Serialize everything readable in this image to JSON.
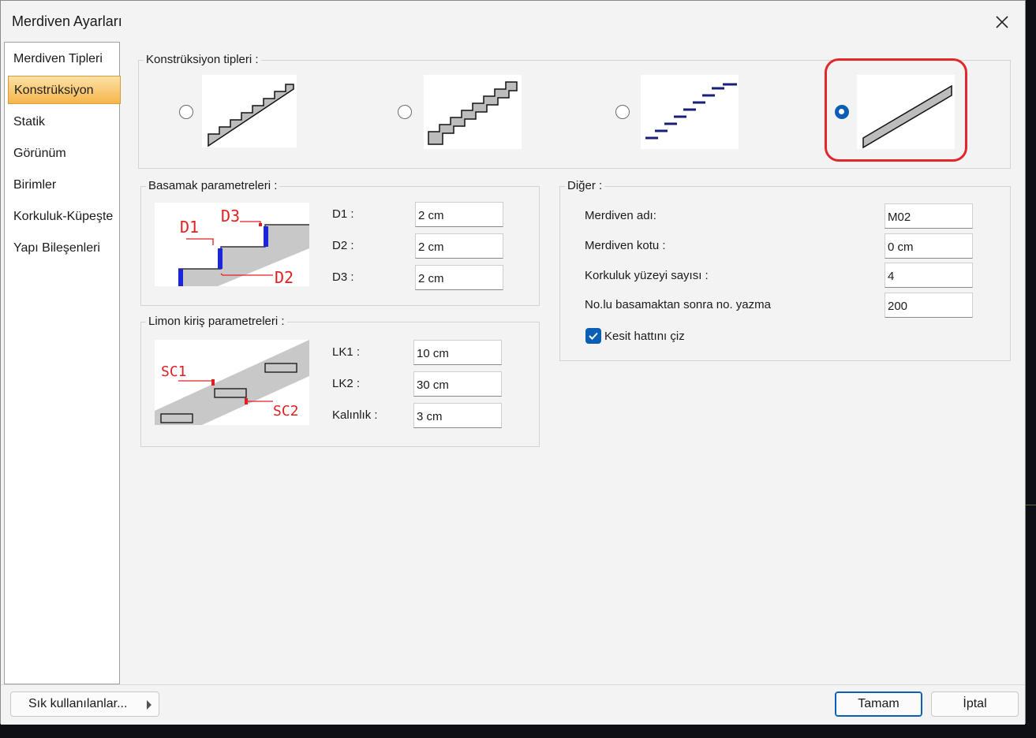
{
  "window": {
    "title": "Merdiven Ayarları"
  },
  "sidebar": {
    "items": [
      {
        "label": "Merdiven Tipleri",
        "active": false
      },
      {
        "label": "Konstrüksiyon",
        "active": true
      },
      {
        "label": "Statik",
        "active": false
      },
      {
        "label": "Görünüm",
        "active": false
      },
      {
        "label": "Birimler",
        "active": false
      },
      {
        "label": "Korkuluk-Küpeşte",
        "active": false
      },
      {
        "label": "Yapı Bileşenleri",
        "active": false
      }
    ]
  },
  "construction": {
    "title": "Konstrüksiyon tipleri :",
    "selected_index": 3,
    "options": [
      {
        "icon": "stepped-stair-icon"
      },
      {
        "icon": "zigzag-stair-icon"
      },
      {
        "icon": "floating-treads-icon"
      },
      {
        "icon": "inclined-slab-icon"
      }
    ]
  },
  "step_params": {
    "title": "Basamak parametreleri :",
    "diagram_labels": {
      "d1": "D1",
      "d2": "D2",
      "d3": "D3"
    },
    "fields": [
      {
        "label": "D1 :",
        "value": "2 cm"
      },
      {
        "label": "D2 :",
        "value": "2 cm"
      },
      {
        "label": "D3 :",
        "value": "2 cm"
      }
    ]
  },
  "stringer_params": {
    "title": "Limon kiriş parametreleri :",
    "diagram_labels": {
      "sc1": "SC1",
      "sc2": "SC2"
    },
    "fields": [
      {
        "label": "LK1 :",
        "value": "10 cm"
      },
      {
        "label": "LK2 :",
        "value": "30 cm"
      },
      {
        "label": "Kalınlık :",
        "value": "3 cm"
      }
    ]
  },
  "other": {
    "title": "Diğer :",
    "fields": [
      {
        "label": "Merdiven adı:",
        "value": "M02"
      },
      {
        "label": "Merdiven kotu :",
        "value": "0 cm"
      },
      {
        "label": "Korkuluk yüzeyi sayısı :",
        "value": "4"
      },
      {
        "label": "No.lu basamaktan sonra no. yazma",
        "value": "200"
      }
    ],
    "checkbox": {
      "label": "Kesit hattını çiz",
      "checked": true
    }
  },
  "footer": {
    "favorites_label": "Sık kullanılanlar...",
    "ok_label": "Tamam",
    "cancel_label": "İptal"
  },
  "colors": {
    "accent": "#0a5fb4",
    "highlight": "#e3262b",
    "sidebar_active": "#f6b54d"
  }
}
